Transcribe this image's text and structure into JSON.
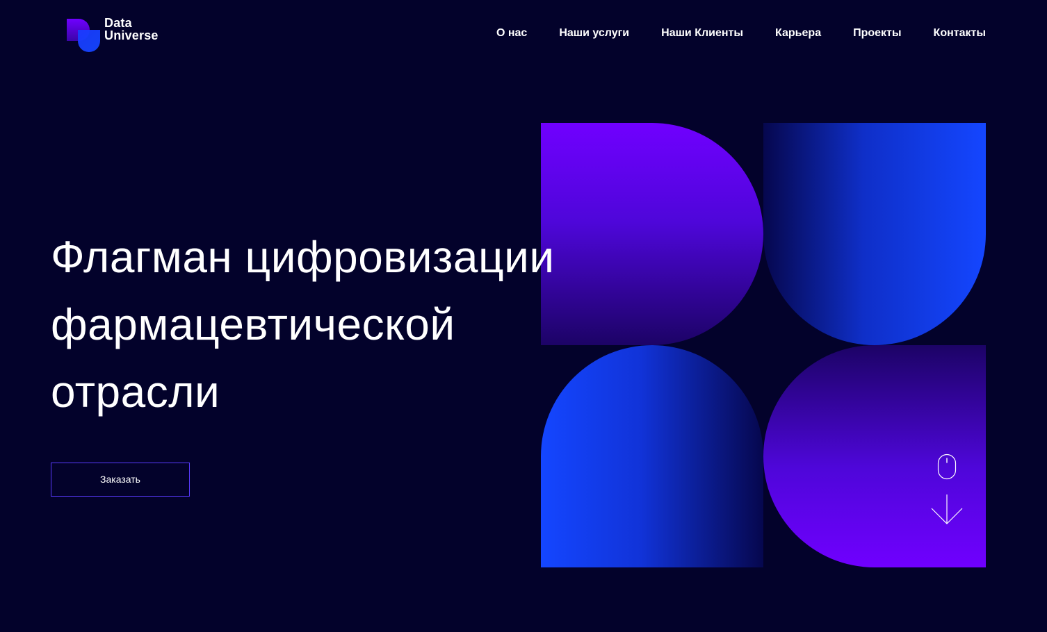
{
  "header": {
    "logo": {
      "line1": "Data",
      "line2": "Universe",
      "icon": "data-universe-logo-icon"
    },
    "nav": [
      {
        "label": "О нас"
      },
      {
        "label": "Наши услуги"
      },
      {
        "label": "Наши Клиенты"
      },
      {
        "label": "Карьера"
      },
      {
        "label": "Проекты"
      },
      {
        "label": "Контакты"
      }
    ]
  },
  "hero": {
    "title_lines": [
      "Флагман цифровизации",
      "фармацевтической",
      "отрасли"
    ],
    "button_label": "Заказать"
  },
  "art": {
    "icons": [
      "mouse-icon",
      "arrow-down-icon"
    ]
  },
  "colors": {
    "background": "#03022b",
    "violet": "#7000ff",
    "blue": "#1446ff",
    "button_border": "#5a3bff",
    "text": "#ffffff"
  }
}
